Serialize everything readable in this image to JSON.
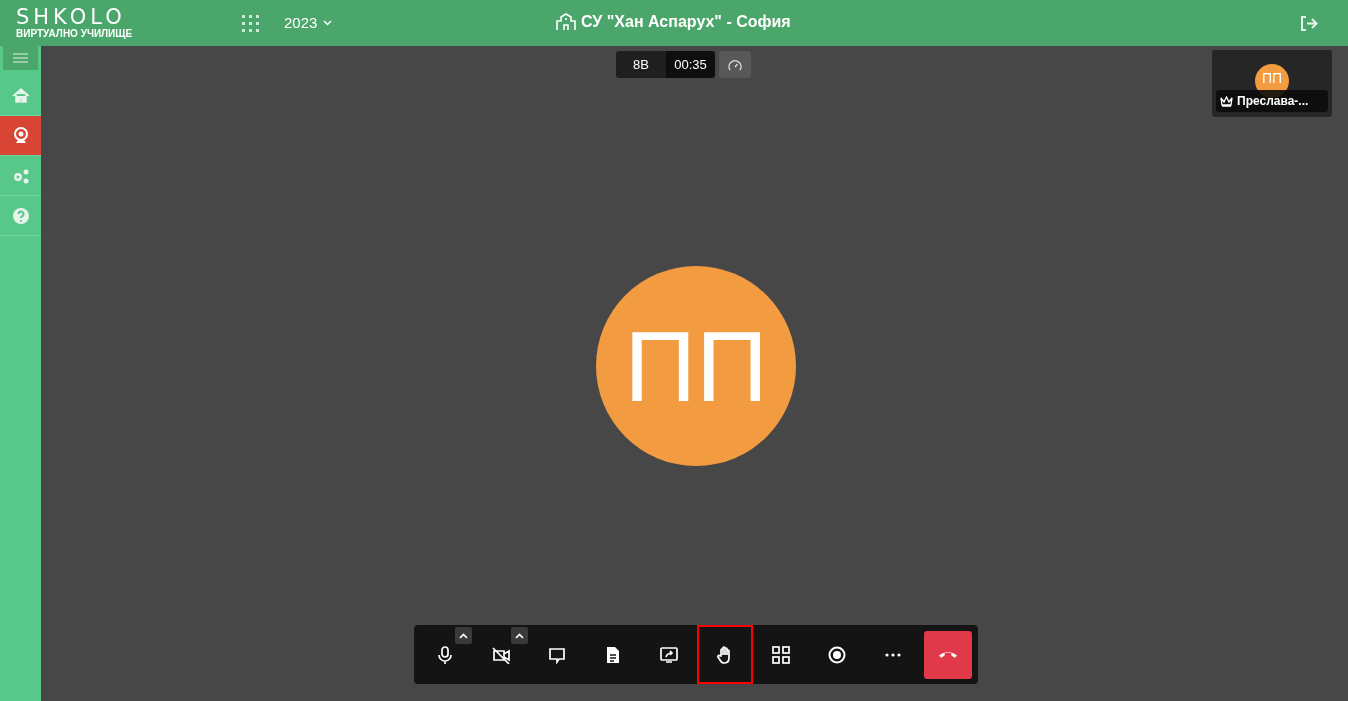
{
  "header": {
    "logo": "SHKOLO",
    "logo_subtitle": "ВИРТУАЛНО УЧИЛИЩЕ",
    "year": "2023",
    "school": "СУ \"Хан Аспарух\" - София"
  },
  "sidebar": {
    "menu_open": true,
    "items": [
      {
        "kind": "home",
        "selected": false
      },
      {
        "kind": "webcam",
        "selected": true
      },
      {
        "kind": "settings",
        "selected": false
      },
      {
        "kind": "help",
        "selected": false
      }
    ]
  },
  "meeting": {
    "room": "8В",
    "timer": "00:35",
    "avatar_initials": "ПП",
    "participant": {
      "initials": "ПП",
      "name": "Преслава-..."
    }
  },
  "toolbar": [
    {
      "kind": "mic",
      "selected": false
    },
    {
      "kind": "camera-off",
      "selected": false
    },
    {
      "kind": "chat",
      "selected": false
    },
    {
      "kind": "document",
      "selected": false
    },
    {
      "kind": "share",
      "selected": false
    },
    {
      "kind": "hand",
      "selected": true
    },
    {
      "kind": "grid",
      "selected": false
    },
    {
      "kind": "record",
      "selected": false
    },
    {
      "kind": "more",
      "selected": false
    },
    {
      "kind": "hangup",
      "selected": false
    }
  ]
}
